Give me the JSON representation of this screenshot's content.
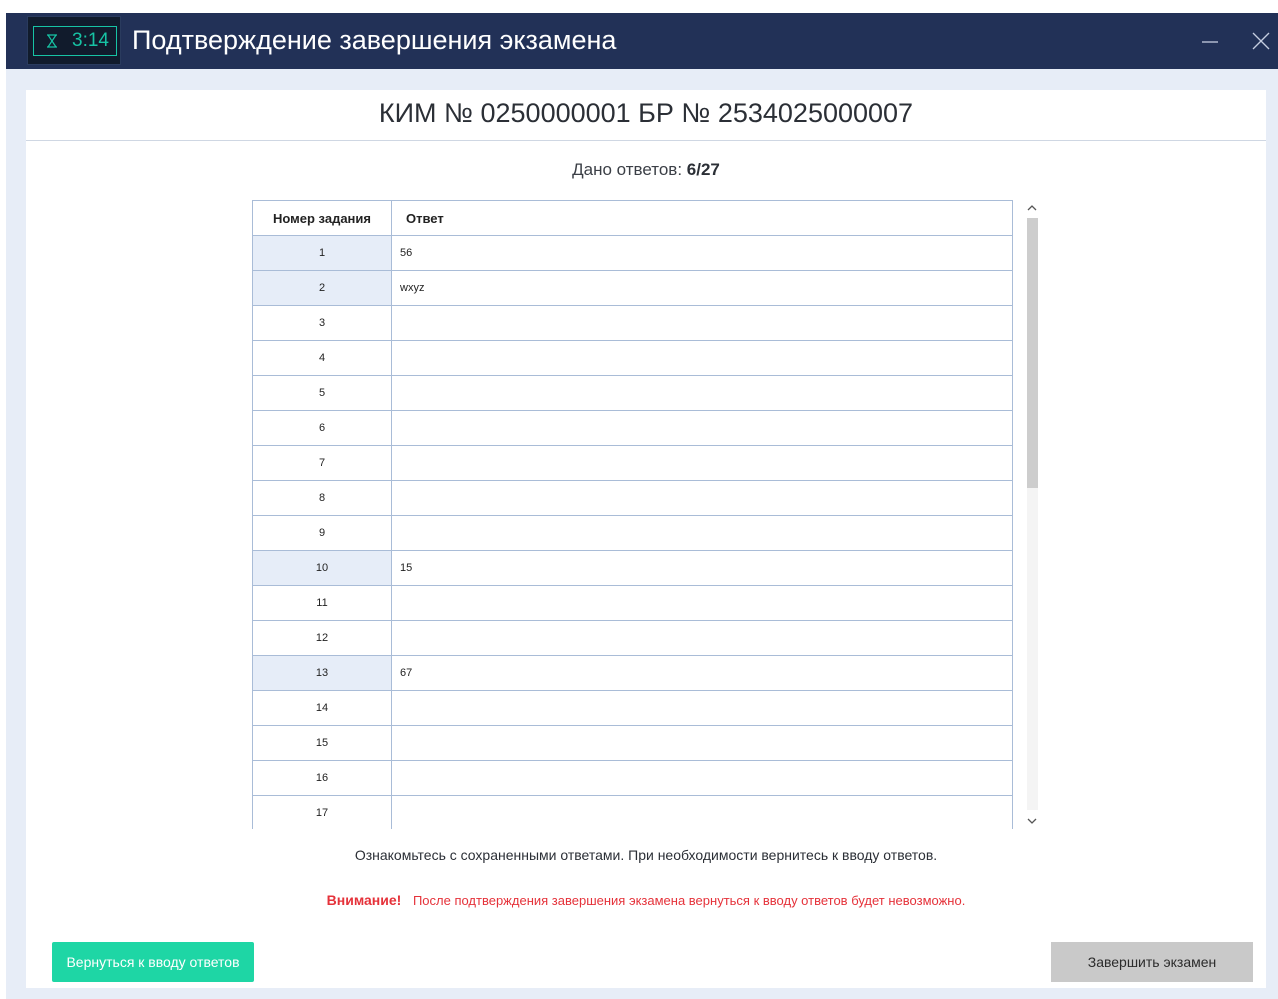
{
  "titlebar": {
    "timer": "3:14",
    "timer_icon": "hourglass-icon",
    "title": "Подтверждение завершения экзамена",
    "minimize_icon": "minimize-icon",
    "close_icon": "close-icon"
  },
  "header": {
    "kim_label": "КИМ № 0250000001 БР № 2534025000007"
  },
  "summary": {
    "answered_label": "Дано ответов:",
    "answered_value": "6/27"
  },
  "table": {
    "columns": [
      "Номер задания",
      "Ответ"
    ],
    "rows": [
      {
        "num": "1",
        "answer": "56"
      },
      {
        "num": "2",
        "answer": "wxyz"
      },
      {
        "num": "3",
        "answer": ""
      },
      {
        "num": "4",
        "answer": ""
      },
      {
        "num": "5",
        "answer": ""
      },
      {
        "num": "6",
        "answer": ""
      },
      {
        "num": "7",
        "answer": ""
      },
      {
        "num": "8",
        "answer": ""
      },
      {
        "num": "9",
        "answer": ""
      },
      {
        "num": "10",
        "answer": "15"
      },
      {
        "num": "11",
        "answer": ""
      },
      {
        "num": "12",
        "answer": ""
      },
      {
        "num": "13",
        "answer": "67"
      },
      {
        "num": "14",
        "answer": ""
      },
      {
        "num": "15",
        "answer": ""
      },
      {
        "num": "16",
        "answer": ""
      },
      {
        "num": "17",
        "answer": ""
      }
    ]
  },
  "messages": {
    "info": "Ознакомьтесь с сохраненными ответами. При необходимости вернитесь к вводу ответов.",
    "warning_title": "Внимание!",
    "warning_text": "После подтверждения завершения экзамена вернуться к вводу ответов будет невозможно."
  },
  "buttons": {
    "back_label": "Вернуться к вводу ответов",
    "finish_label": "Завершить экзамен"
  },
  "colors": {
    "titlebar": "#223157",
    "accent": "#1ed6a5",
    "timer": "#17c3a4",
    "warning": "#e5323a",
    "answered_cell": "#e6edf8"
  }
}
